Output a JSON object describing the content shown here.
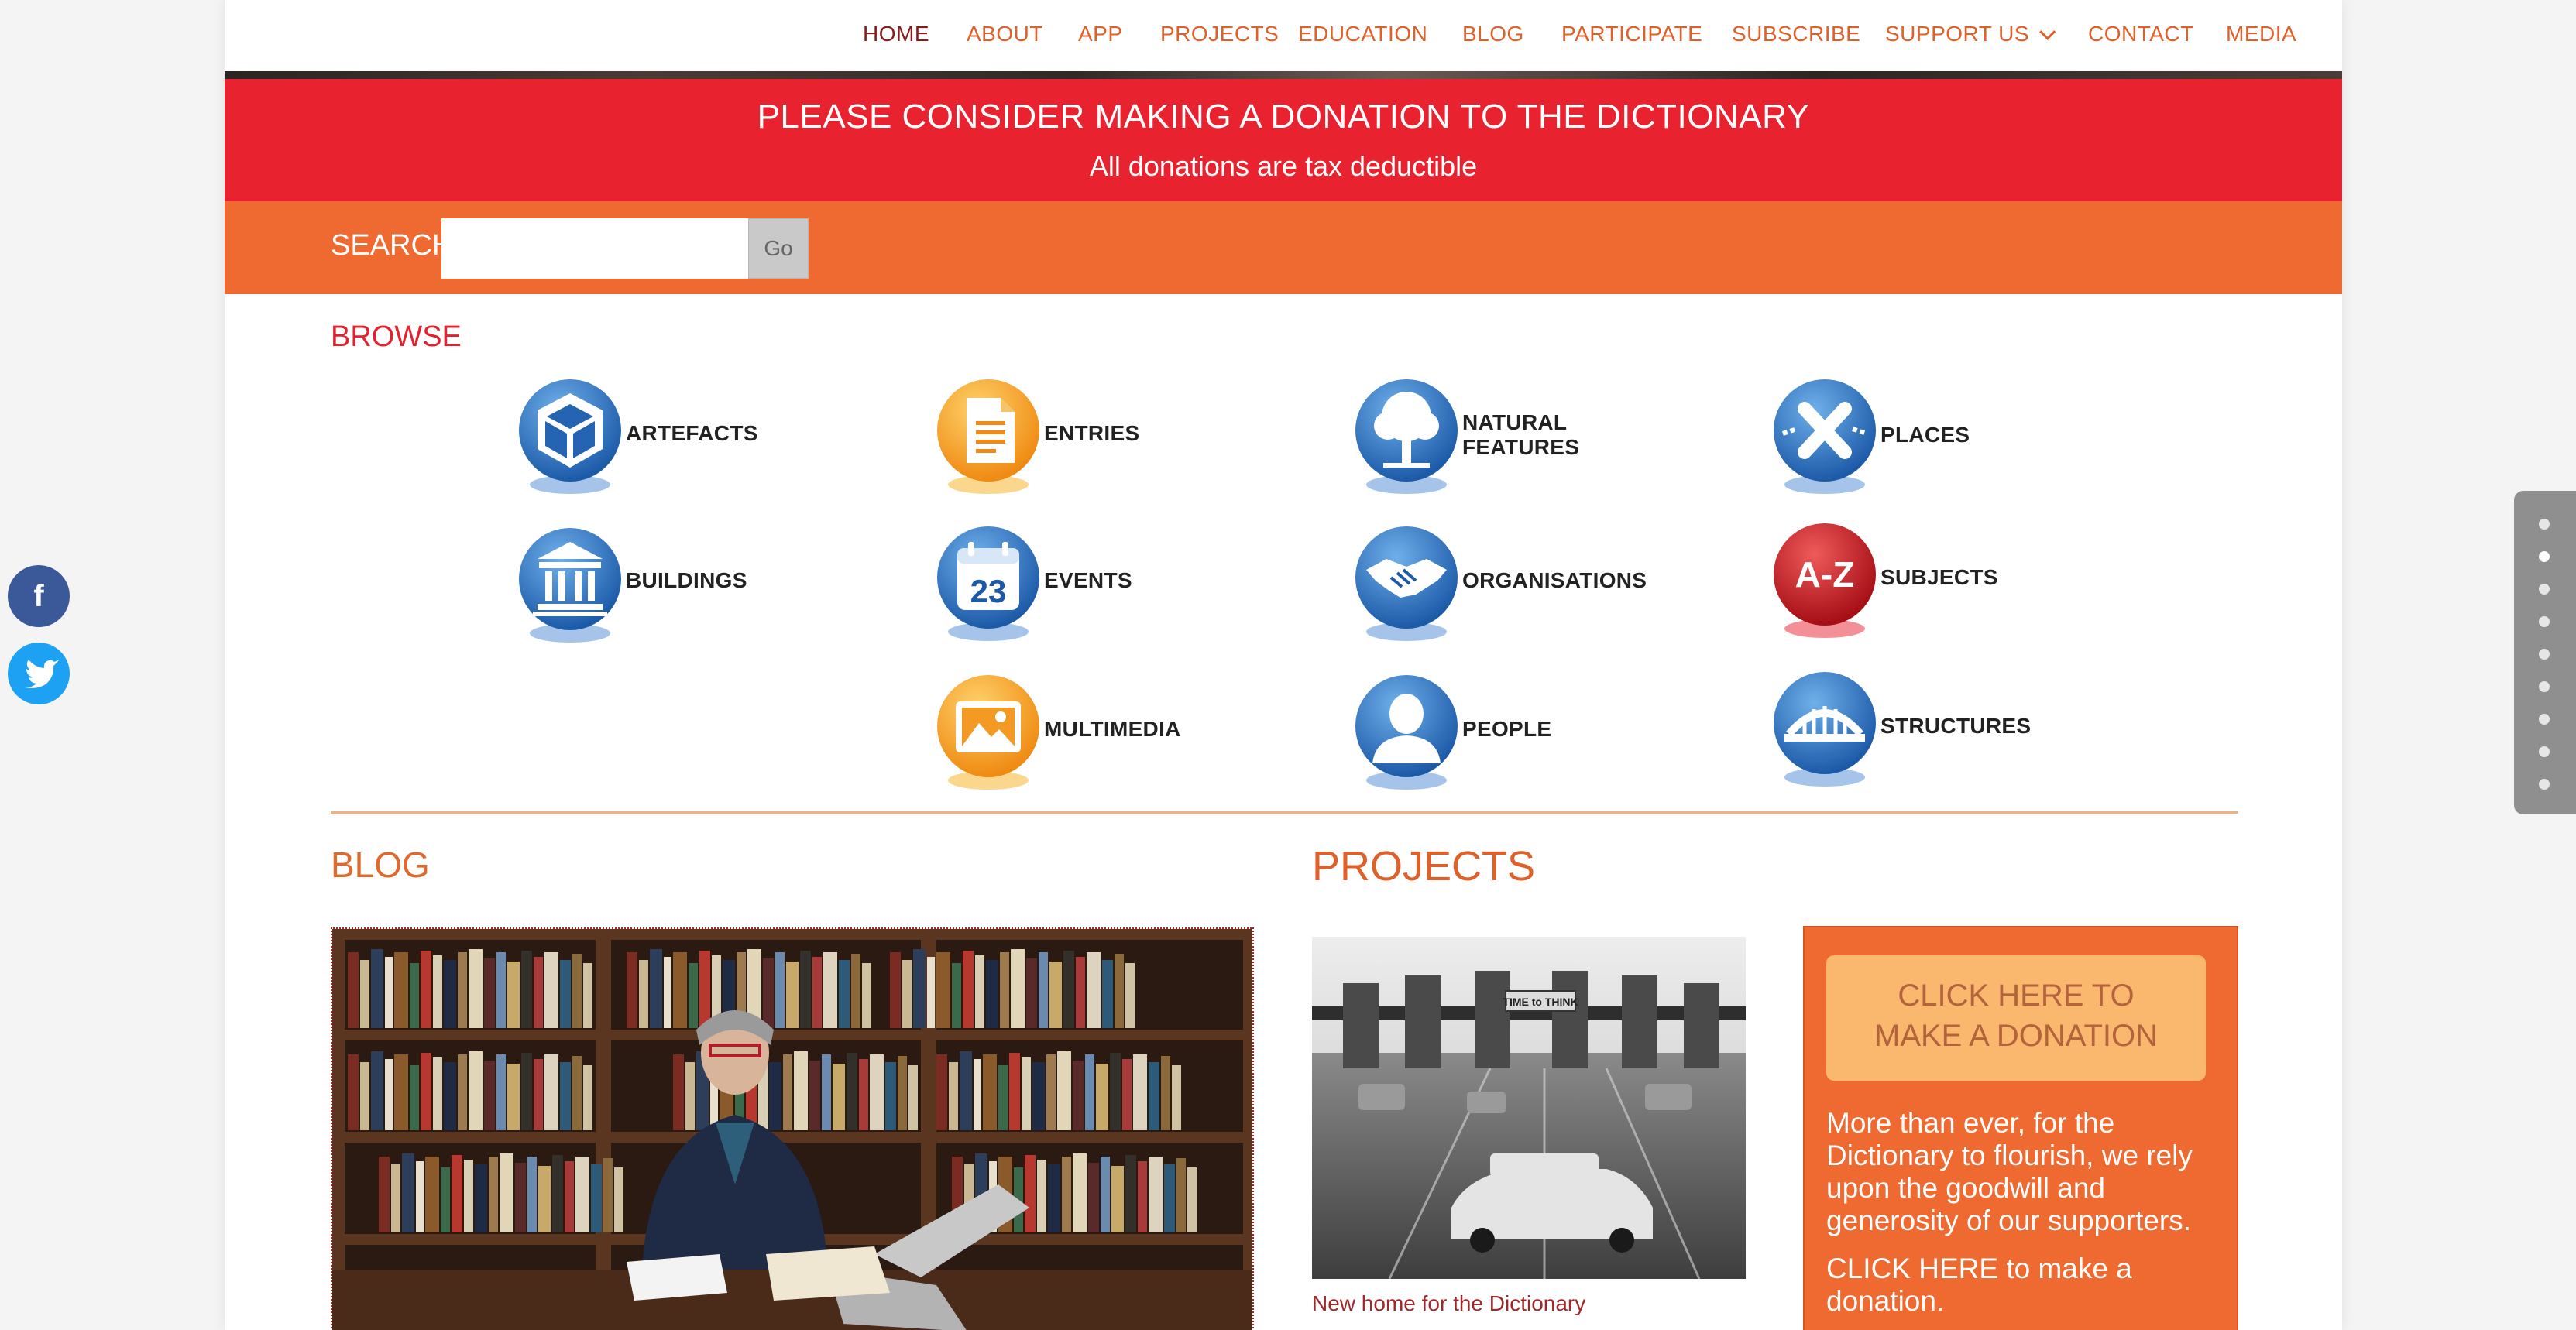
{
  "nav": {
    "items": [
      {
        "label": "HOME",
        "active": true
      },
      {
        "label": "ABOUT"
      },
      {
        "label": "APP"
      },
      {
        "label": "PROJECTS"
      },
      {
        "label": "EDUCATION"
      },
      {
        "label": "BLOG"
      },
      {
        "label": "PARTICIPATE"
      },
      {
        "label": "SUBSCRIBE"
      },
      {
        "label": "SUPPORT US"
      },
      {
        "label": "CONTACT"
      },
      {
        "label": "MEDIA"
      }
    ]
  },
  "donation_banner": {
    "title": "PLEASE CONSIDER MAKING A DONATION TO THE DICTIONARY",
    "subtitle": "All donations are tax deductible"
  },
  "search": {
    "label": "SEARCH",
    "value": "",
    "go_label": "Go"
  },
  "browse": {
    "heading": "BROWSE",
    "items": [
      {
        "label": "ARTEFACTS",
        "icon": "artefacts-icon",
        "color": "blue"
      },
      {
        "label": "ENTRIES",
        "icon": "entries-icon",
        "color": "orange"
      },
      {
        "label": "NATURAL\nFEATURES",
        "icon": "tree-icon",
        "color": "blue"
      },
      {
        "label": "PLACES",
        "icon": "map-marker-icon",
        "color": "blue"
      },
      {
        "label": "BUILDINGS",
        "icon": "building-icon",
        "color": "blue"
      },
      {
        "label": "EVENTS",
        "icon": "calendar-icon",
        "color": "blue"
      },
      {
        "label": "ORGANISATIONS",
        "icon": "handshake-icon",
        "color": "blue"
      },
      {
        "label": "SUBJECTS",
        "icon": "a-z-icon",
        "color": "red"
      },
      {
        "label": "MULTIMEDIA",
        "icon": "image-icon",
        "color": "orange"
      },
      {
        "label": "PEOPLE",
        "icon": "person-icon",
        "color": "blue"
      },
      {
        "label": "STRUCTURES",
        "icon": "bridge-icon",
        "color": "blue"
      }
    ]
  },
  "blog": {
    "heading": "BLOG"
  },
  "projects": {
    "heading": "PROJECTS",
    "caption": "New home for the Dictionary",
    "image_sign_text": "TIME to THINK"
  },
  "donate_box": {
    "button_line1": "CLICK HERE TO",
    "button_line2": "MAKE A DONATION",
    "text": "More than ever, for the Dictionary to flourish, we rely upon the goodwill and generosity of our supporters.",
    "cta": "CLICK HERE to make a donation."
  },
  "social": {
    "facebook_glyph": "f"
  },
  "section_dots": {
    "count": 9,
    "active_index": 1
  },
  "colors": {
    "accent_orange": "#ee6a30",
    "banner_red": "#e8222f",
    "nav_text": "#e0602a",
    "nav_active": "#8a1b1b"
  }
}
